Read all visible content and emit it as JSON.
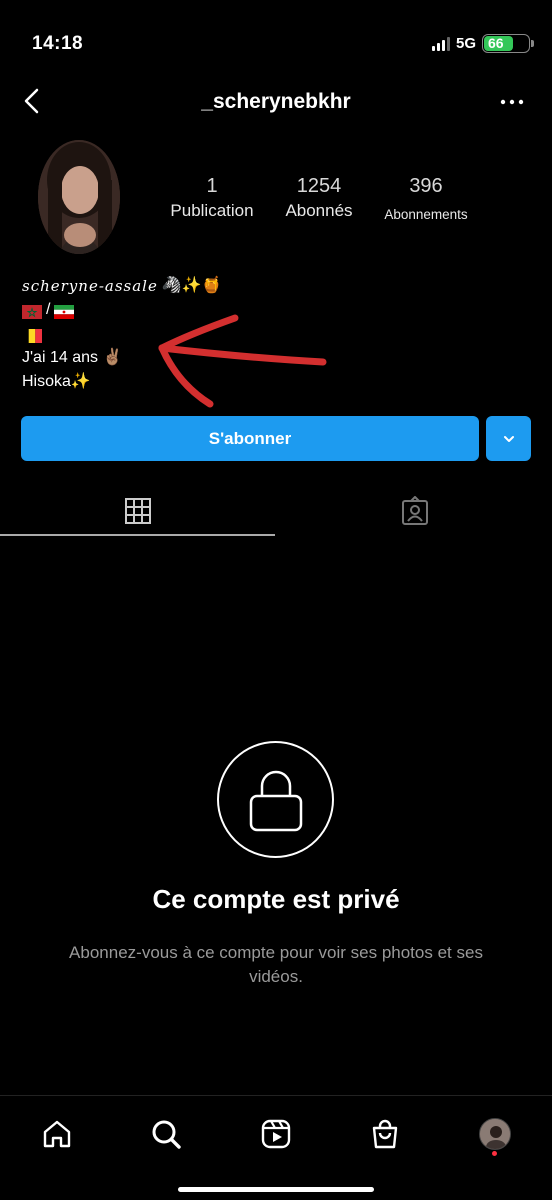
{
  "status_bar": {
    "time": "14:18",
    "network": "5G",
    "battery_level": "66",
    "battery_color": "#34c759"
  },
  "header": {
    "username": "_scherynebkhr",
    "back_icon": "chevron-left-icon",
    "more_icon": "more-horizontal-icon"
  },
  "profile": {
    "stats": [
      {
        "value": "1",
        "label": "Publication"
      },
      {
        "value": "1254",
        "label": "Abonnés"
      },
      {
        "value": "396",
        "label": "Abonnements"
      }
    ],
    "bio": {
      "name": "scheryne-assale",
      "name_emoji": "🦓✨🍯",
      "line2_sep": "/",
      "age_line": "J'ai 14 ans ✌🏽",
      "last_line": "Hisoka✨"
    }
  },
  "actions": {
    "follow_label": "S'abonner",
    "accent_color": "#1d9bf0"
  },
  "tabs": [
    {
      "icon": "grid-icon",
      "active": true
    },
    {
      "icon": "tagged-icon",
      "active": false
    }
  ],
  "private": {
    "icon": "lock-icon",
    "title": "Ce compte est privé",
    "subtitle": "Abonnez-vous à ce compte pour voir ses photos et ses vidéos."
  },
  "bottom_nav": [
    {
      "icon": "home-icon"
    },
    {
      "icon": "search-icon"
    },
    {
      "icon": "reels-icon"
    },
    {
      "icon": "shop-icon"
    },
    {
      "icon": "profile-avatar"
    }
  ]
}
